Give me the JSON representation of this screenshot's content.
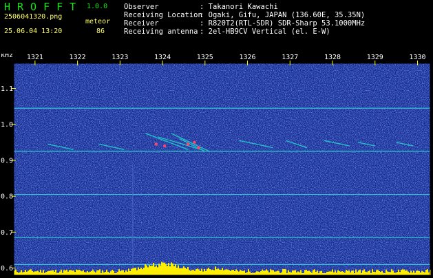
{
  "header": {
    "logo": "HROFFT",
    "version": "1.0.0",
    "filename": "2506041320.png",
    "datetime": "25.06.04 13:20",
    "mode_label": "meteor",
    "count": "86"
  },
  "info": [
    {
      "label": "Observer",
      "value": ": Takanori Kawachi"
    },
    {
      "label": "Receiving Location",
      "value": ": Ogaki, Gifu, JAPAN (136.60E, 35.35N)"
    },
    {
      "label": "Receiver",
      "value": ": R820T2(RTL-SDR) SDR-Sharp 53.1000MHz"
    },
    {
      "label": "Receiving antenna",
      "value": ": 2el-HB9CV Vertical (el. E-W)"
    }
  ],
  "chart_data": {
    "type": "heatmap",
    "ylabel": "kHz",
    "x_ticks": [
      "1321",
      "1322",
      "1323",
      "1324",
      "1325",
      "1326",
      "1327",
      "1328",
      "1329",
      "1330"
    ],
    "y_ticks": [
      "1.1",
      "1.0",
      "0.9",
      "0.8",
      "0.7",
      "0.6"
    ],
    "xlim": [
      1320.5,
      1330.3
    ],
    "ylim": [
      0.58,
      1.17
    ],
    "carrier_lines_khz": [
      1.045,
      0.925,
      0.805,
      0.685,
      0.61
    ],
    "colors": {
      "background": "#1a2a8e",
      "carrier": "#33dddd",
      "meteor": "#22cccc",
      "meteor_hot": "#ff4466",
      "bottom_band": "#ffee00",
      "axis": "#ffff00",
      "tick_text": "#ffffff",
      "frame": "#000000"
    }
  }
}
